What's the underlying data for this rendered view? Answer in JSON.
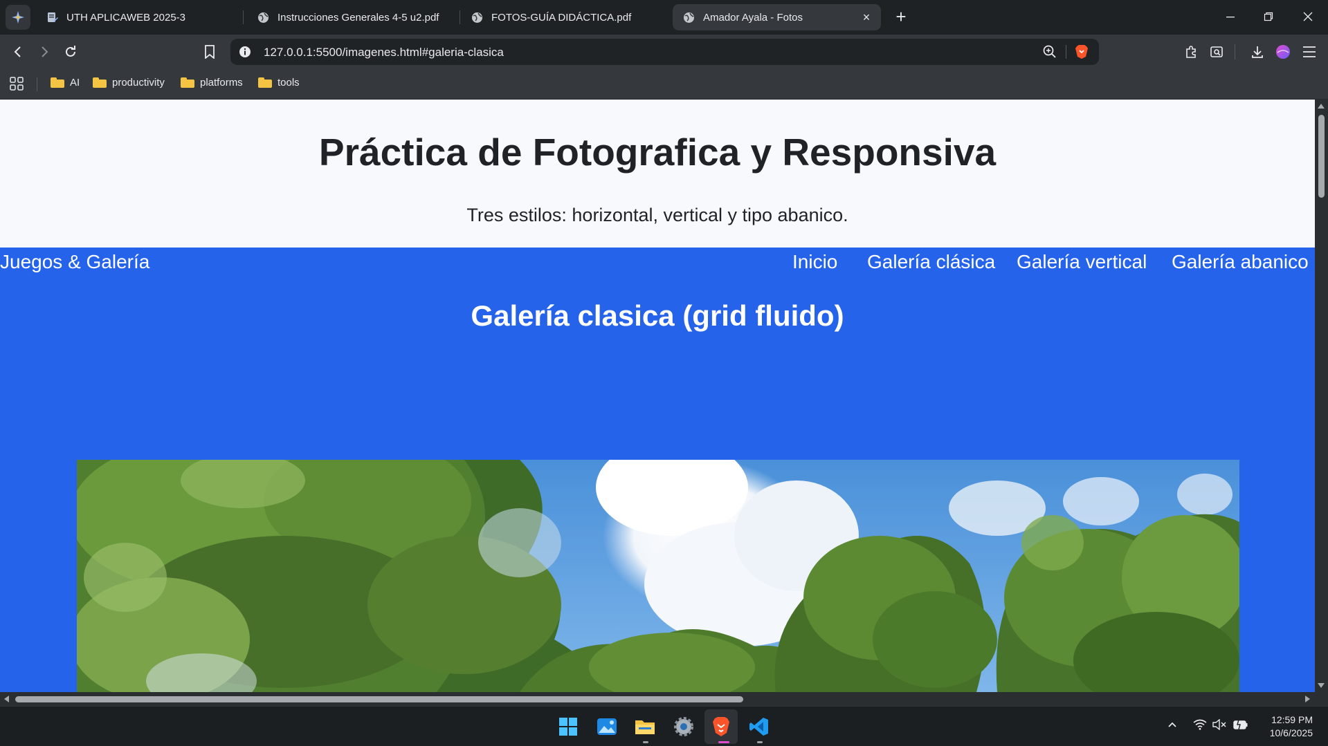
{
  "browser": {
    "tabs": [
      {
        "label": "UTH APLICAWEB 2025-3",
        "active": false
      },
      {
        "label": "Instrucciones Generales 4-5 u2.pdf",
        "active": false
      },
      {
        "label": "FOTOS-GUÍA DIDÁCTICA.pdf",
        "active": false
      },
      {
        "label": "Amador Ayala - Fotos",
        "active": true
      }
    ],
    "new_tab": "+",
    "url": "127.0.0.1:5500/imagenes.html#galeria-clasica",
    "bookmarks": [
      {
        "label": "AI"
      },
      {
        "label": "productivity"
      },
      {
        "label": "platforms"
      },
      {
        "label": "tools"
      }
    ],
    "accent": "#f6c445"
  },
  "page": {
    "title": "Práctica de Fotografica y Responsiva",
    "subtitle": "Tres estilos: horizontal, vertical y tipo abanico.",
    "nav": {
      "brand": "Juegos & Galería",
      "links": [
        "Inicio",
        "Galería clásica",
        "Galería vertical",
        "Galería abanico"
      ]
    },
    "section_title": "Galería clasica (grid fluido)",
    "colors": {
      "nav_bg": "#2563eb",
      "header_bg": "#f8f9fc",
      "text": "#1f2328"
    },
    "photo": {
      "subject": "trees and blue sky with clouds"
    }
  },
  "taskbar": {
    "apps": [
      "start-icon",
      "photos-icon",
      "file-explorer-icon",
      "settings-icon",
      "brave-browser-icon",
      "vscode-icon"
    ],
    "time": "12:59 PM",
    "date": "10/6/2025"
  }
}
